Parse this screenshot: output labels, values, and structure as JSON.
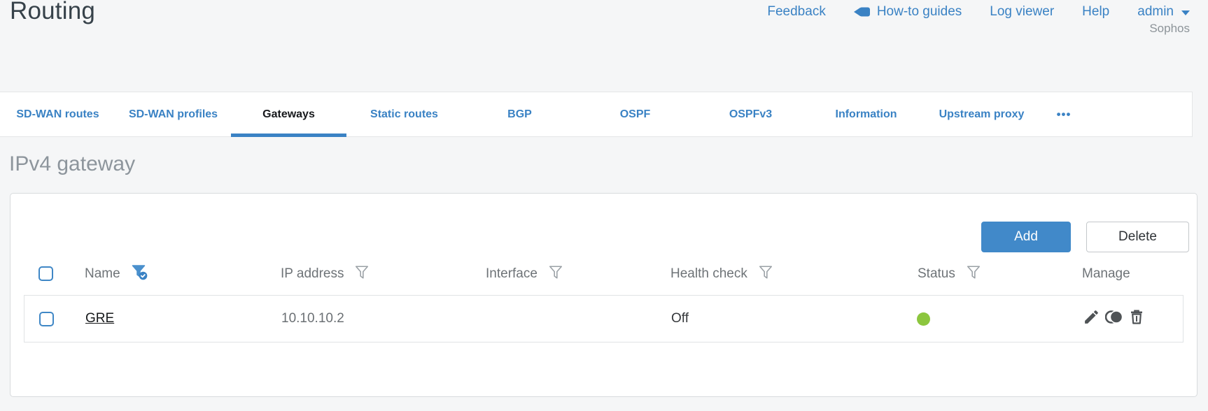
{
  "header": {
    "title": "Routing",
    "links": {
      "feedback": "Feedback",
      "howto": "How-to guides",
      "logviewer": "Log viewer",
      "help": "Help",
      "user": "admin"
    },
    "brand": "Sophos"
  },
  "tabs": {
    "items": [
      "SD-WAN routes",
      "SD-WAN profiles",
      "Gateways",
      "Static routes",
      "BGP",
      "OSPF",
      "OSPFv3",
      "Information",
      "Upstream proxy"
    ],
    "active": "Gateways",
    "overflow": "•••"
  },
  "section": {
    "title": "IPv4 gateway"
  },
  "toolbar": {
    "add": "Add",
    "delete": "Delete"
  },
  "table": {
    "columns": [
      {
        "label": "Name",
        "filter": "active"
      },
      {
        "label": "IP address",
        "filter": "inactive"
      },
      {
        "label": "Interface",
        "filter": "inactive"
      },
      {
        "label": "Health check",
        "filter": "inactive"
      },
      {
        "label": "Status",
        "filter": "inactive"
      },
      {
        "label": "Manage",
        "filter": "none"
      }
    ],
    "rows": [
      {
        "name": "GRE",
        "ip": "10.10.10.2",
        "interface": "",
        "health_check": "Off",
        "status": "up",
        "status_color": "#8cc63e",
        "actions": [
          "edit",
          "clone",
          "delete"
        ]
      }
    ]
  },
  "colors": {
    "accent_blue": "#3a82c4",
    "button_blue": "#4189c9",
    "status_green": "#8cc63e",
    "title_gray": "#37424a",
    "section_gray": "#8d959c",
    "page_bg": "#f5f6f7"
  }
}
